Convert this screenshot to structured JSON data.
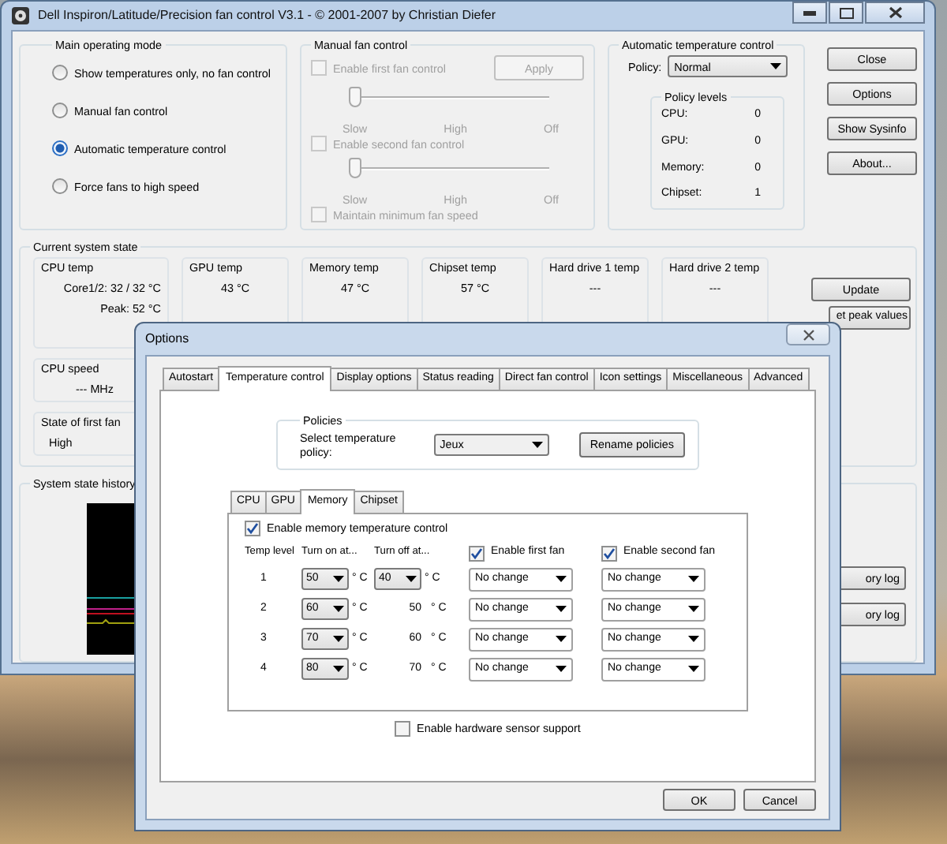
{
  "window": {
    "title": "Dell Inspiron/Latitude/Precision fan control V3.1 - © 2001-2007 by Christian Diefer"
  },
  "operating_mode": {
    "title": "Main operating mode",
    "options": [
      {
        "label": "Show temperatures only, no fan control",
        "selected": false
      },
      {
        "label": "Manual fan control",
        "selected": false
      },
      {
        "label": "Automatic temperature control",
        "selected": true
      },
      {
        "label": "Force fans to high speed",
        "selected": false
      }
    ]
  },
  "manual_fan_control": {
    "title": "Manual fan control",
    "apply": "Apply",
    "apply_disabled": true,
    "fans": [
      {
        "label": "Enable first fan control",
        "checked": false,
        "disabled": true,
        "level": 0,
        "ticks": [
          "Slow",
          "High",
          "Off"
        ]
      },
      {
        "label": "Enable second fan control",
        "checked": false,
        "disabled": true,
        "level": 0,
        "ticks": [
          "Slow",
          "High",
          "Off"
        ]
      }
    ],
    "maintain": {
      "label": "Maintain minimum fan speed",
      "checked": false,
      "disabled": true
    }
  },
  "auto_control": {
    "title": "Automatic temperature control",
    "policy_label": "Policy:",
    "policy": "Normal",
    "levels_title": "Policy levels",
    "levels": [
      {
        "name": "CPU:",
        "value": "0"
      },
      {
        "name": "GPU:",
        "value": "0"
      },
      {
        "name": "Memory:",
        "value": "0"
      },
      {
        "name": "Chipset:",
        "value": "1"
      }
    ]
  },
  "side_buttons": [
    "Close",
    "Options",
    "Show Sysinfo",
    "About..."
  ],
  "system_state": {
    "title": "Current system state",
    "temps": [
      {
        "name": "CPU temp",
        "value": "Core1/2: 32 / 32 °C",
        "peak": "Peak: 52 °C"
      },
      {
        "name": "GPU temp",
        "value": "43 °C"
      },
      {
        "name": "Memory temp",
        "value": "47 °C"
      },
      {
        "name": "Chipset temp",
        "value": "57 °C"
      },
      {
        "name": "Hard drive 1 temp",
        "value": "---"
      },
      {
        "name": "Hard drive 2 temp",
        "value": "---"
      }
    ],
    "cpu_speed": {
      "name": "CPU speed",
      "value": "--- MHz"
    },
    "fan_state": {
      "name": "State of first fan",
      "value": "High"
    },
    "buttons": [
      "Update",
      "et peak values"
    ]
  },
  "history": {
    "title": "System state history",
    "buttons": [
      "ory log",
      "ory log"
    ]
  },
  "options_dialog": {
    "title": "Options",
    "tabs": [
      {
        "label": "Autostart",
        "selected": false
      },
      {
        "label": "Temperature control",
        "selected": true
      },
      {
        "label": "Display options",
        "selected": false
      },
      {
        "label": "Status reading",
        "selected": false
      },
      {
        "label": "Direct fan control",
        "selected": false
      },
      {
        "label": "Icon settings",
        "selected": false
      },
      {
        "label": "Miscellaneous",
        "selected": false
      },
      {
        "label": "Advanced",
        "selected": false
      }
    ],
    "policies": {
      "title": "Policies",
      "label": "Select temperature policy:",
      "value": "Jeux",
      "rename": "Rename policies"
    },
    "sensor_tabs": [
      {
        "label": "CPU",
        "selected": false
      },
      {
        "label": "GPU",
        "selected": false
      },
      {
        "label": "Memory",
        "selected": true
      },
      {
        "label": "Chipset",
        "selected": false
      }
    ],
    "enable_control": {
      "label": "Enable memory temperature control",
      "checked": true
    },
    "columns": [
      "Temp level",
      "Turn on at...",
      "Turn off at..."
    ],
    "first_fan": {
      "label": "Enable first fan",
      "checked": true
    },
    "second_fan": {
      "label": "Enable second fan",
      "checked": true
    },
    "rows": [
      {
        "level": "1",
        "turn_on": "50",
        "on_unit": "° C",
        "turn_off": {
          "kind": "select",
          "value": "40"
        },
        "off_unit": "° C",
        "fan1": "No change",
        "fan2": "No change"
      },
      {
        "level": "2",
        "turn_on": "60",
        "on_unit": "° C",
        "turn_off": {
          "kind": "text",
          "value": "50"
        },
        "off_unit": "° C",
        "fan1": "No change",
        "fan2": "No change"
      },
      {
        "level": "3",
        "turn_on": "70",
        "on_unit": "° C",
        "turn_off": {
          "kind": "text",
          "value": "60"
        },
        "off_unit": "° C",
        "fan1": "No change",
        "fan2": "No change"
      },
      {
        "level": "4",
        "turn_on": "80",
        "on_unit": "° C",
        "turn_off": {
          "kind": "text",
          "value": "70"
        },
        "off_unit": "° C",
        "fan1": "No change",
        "fan2": "No change"
      }
    ],
    "hardware_sensor": {
      "label": "Enable hardware sensor support",
      "checked": false
    },
    "buttons": [
      "OK",
      "Cancel"
    ]
  }
}
